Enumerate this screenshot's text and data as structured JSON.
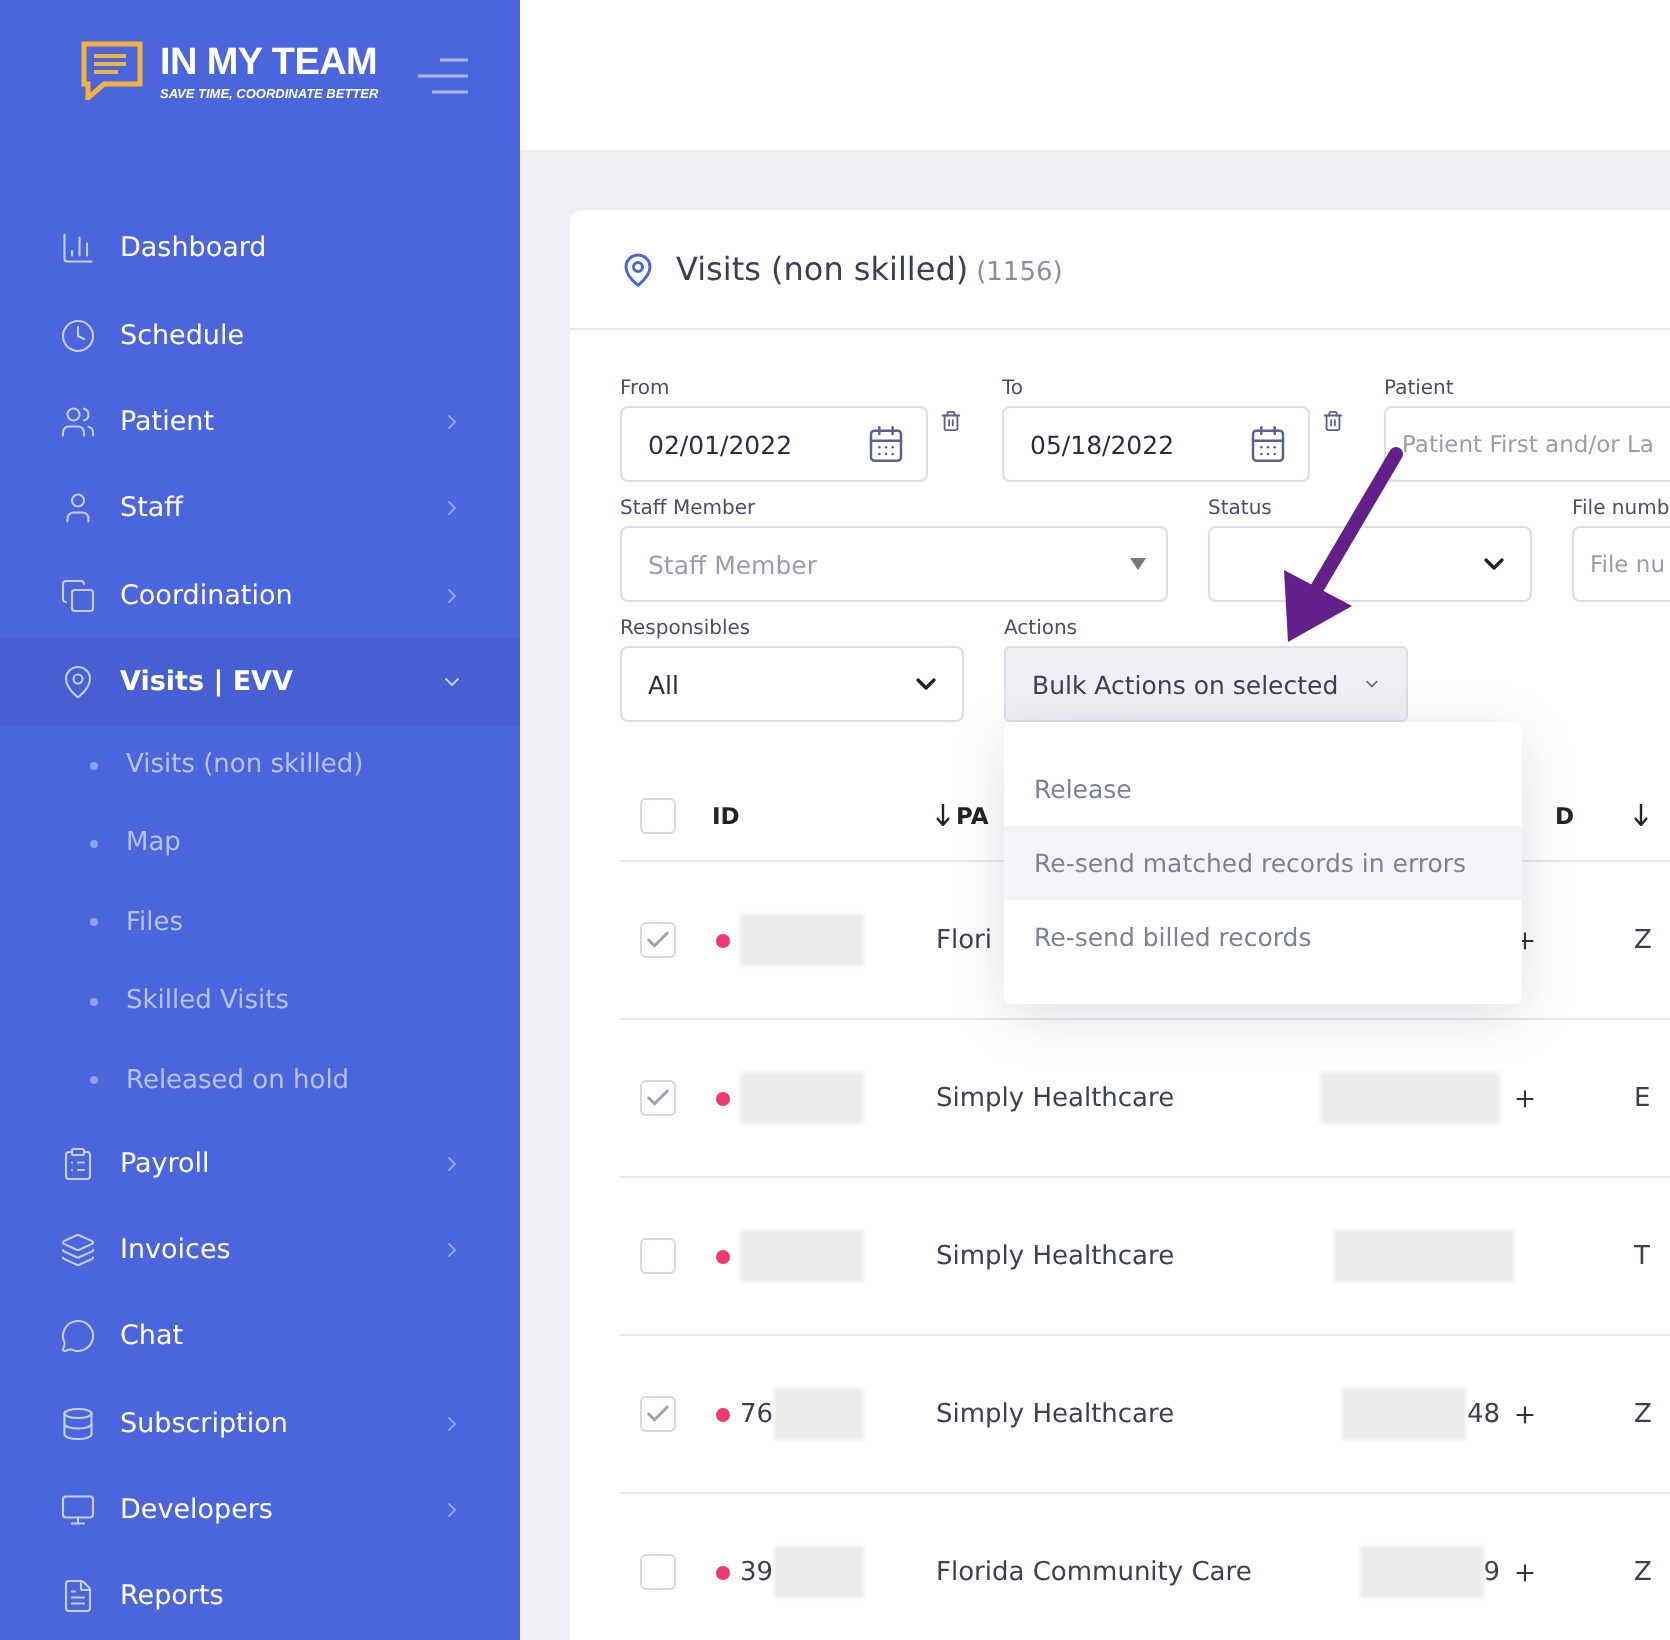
{
  "brand": {
    "name": "IN MY TEAM",
    "tagline": "SAVE TIME, COORDINATE BETTER"
  },
  "sidebar": {
    "items": [
      {
        "label": "Dashboard",
        "has_submenu": false,
        "expanded": false
      },
      {
        "label": "Schedule",
        "has_submenu": false,
        "expanded": false
      },
      {
        "label": "Patient",
        "has_submenu": true,
        "expanded": false
      },
      {
        "label": "Staff",
        "has_submenu": true,
        "expanded": false
      },
      {
        "label": "Coordination",
        "has_submenu": true,
        "expanded": false
      },
      {
        "label": "Visits | EVV",
        "has_submenu": true,
        "expanded": true,
        "children": [
          {
            "label": "Visits (non skilled)"
          },
          {
            "label": "Map"
          },
          {
            "label": "Files"
          },
          {
            "label": "Skilled Visits"
          },
          {
            "label": "Released on hold"
          }
        ]
      },
      {
        "label": "Payroll",
        "has_submenu": true,
        "expanded": false
      },
      {
        "label": "Invoices",
        "has_submenu": true,
        "expanded": false
      },
      {
        "label": "Chat",
        "has_submenu": false,
        "expanded": false
      },
      {
        "label": "Subscription",
        "has_submenu": true,
        "expanded": false
      },
      {
        "label": "Developers",
        "has_submenu": true,
        "expanded": false
      },
      {
        "label": "Reports",
        "has_submenu": false,
        "expanded": false
      }
    ]
  },
  "page": {
    "title": "Visits (non skilled)",
    "count": "(1156)"
  },
  "filter_rows": [
    [
      {
        "kind": "date",
        "label": "From",
        "value": "02/01/2022"
      },
      {
        "kind": "date",
        "label": "To",
        "value": "05/18/2022"
      },
      {
        "kind": "text",
        "label": "Patient",
        "placeholder": "Patient First and/or La"
      }
    ],
    [
      {
        "kind": "combo",
        "label": "Staff Member",
        "placeholder": "Staff Member"
      },
      {
        "kind": "select",
        "label": "Status"
      },
      {
        "kind": "text",
        "label": "File numb",
        "placeholder": "File nu"
      }
    ],
    [
      {
        "kind": "select",
        "label": "Responsibles",
        "value": "All"
      },
      {
        "kind": "menu",
        "label": "Actions",
        "value": "Bulk Actions on selected",
        "expanded": true,
        "items": [
          {
            "label": "Release",
            "highlighted": false
          },
          {
            "label": "Re-send matched records in errors",
            "highlighted": true
          },
          {
            "label": "Re-send billed records",
            "highlighted": false
          }
        ]
      }
    ]
  ],
  "table": {
    "select_all_checked": false,
    "columns": [
      {
        "label": "ID",
        "sorted": false
      },
      {
        "label": "PA",
        "sorted": true
      },
      {
        "label": "D",
        "sorted": false
      },
      {
        "sorted": true
      }
    ],
    "rows": [
      {
        "checked": true,
        "payer": "Flori",
        "has_add": true,
        "column_4": "Z"
      },
      {
        "checked": true,
        "payer": "Simply Healthcare",
        "has_add": true,
        "column_4": "E"
      },
      {
        "checked": false,
        "payer": "Simply Healthcare",
        "has_add": false,
        "column_4": "T"
      },
      {
        "checked": true,
        "id": "76",
        "payer": "Simply Healthcare",
        "column_3": "48",
        "has_add": true,
        "column_4": "Z"
      },
      {
        "checked": false,
        "id": "39",
        "payer": "Florida Community Care",
        "column_3": "9",
        "has_add": true,
        "column_4": "Z"
      }
    ]
  }
}
